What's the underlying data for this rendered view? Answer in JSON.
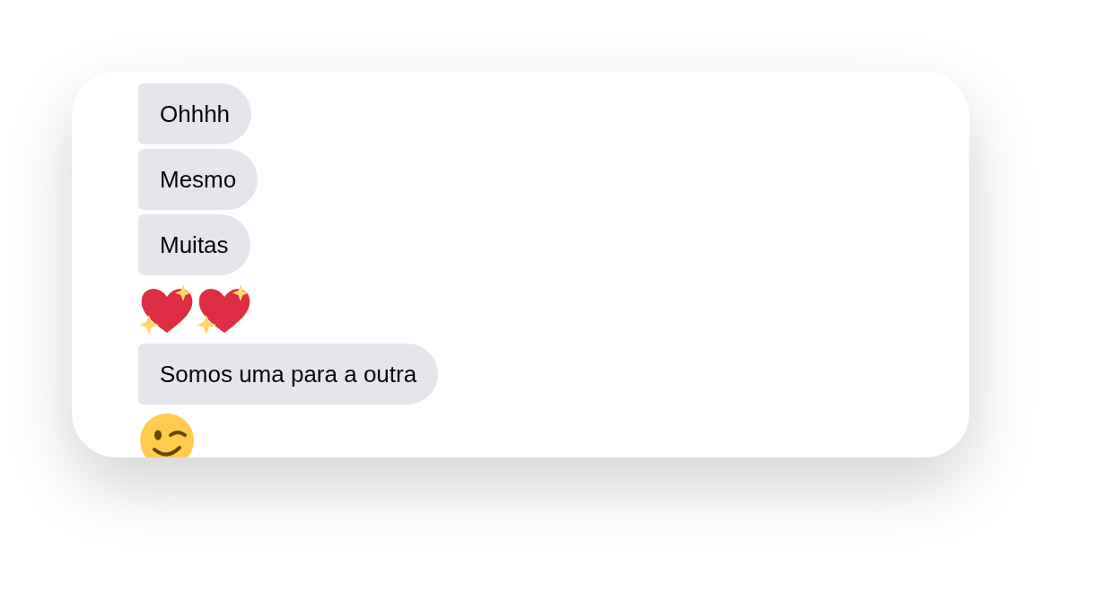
{
  "messages": [
    {
      "kind": "text",
      "text": "Ohhhh"
    },
    {
      "kind": "text",
      "text": "Mesmo"
    },
    {
      "kind": "text",
      "text": "Muitas"
    },
    {
      "kind": "hearts"
    },
    {
      "kind": "text",
      "text": "Somos uma para a outra"
    },
    {
      "kind": "wink"
    }
  ]
}
